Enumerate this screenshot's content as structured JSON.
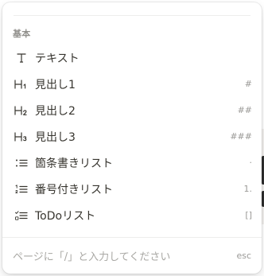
{
  "menu": {
    "section_heading": "基本",
    "items": [
      {
        "label": "テキスト",
        "shortcut": "",
        "icon": "text-icon"
      },
      {
        "label": "見出し1",
        "shortcut": "#",
        "icon": "heading-1-icon"
      },
      {
        "label": "見出し2",
        "shortcut": "##",
        "icon": "heading-2-icon"
      },
      {
        "label": "見出し3",
        "shortcut": "###",
        "icon": "heading-3-icon"
      },
      {
        "label": "箇条書きリスト",
        "shortcut": "·",
        "icon": "bulleted-list-icon"
      },
      {
        "label": "番号付きリスト",
        "shortcut": "1.",
        "icon": "numbered-list-icon"
      },
      {
        "label": "ToDoリスト",
        "shortcut": "[]",
        "icon": "todo-list-icon"
      }
    ]
  },
  "footer": {
    "hint": "ページに「/」と入力してください",
    "esc_label": "esc"
  },
  "colors": {
    "text": "#37352f",
    "muted": "#9b9a97",
    "heading": "#8f8e8a",
    "divider": "#ededec"
  }
}
